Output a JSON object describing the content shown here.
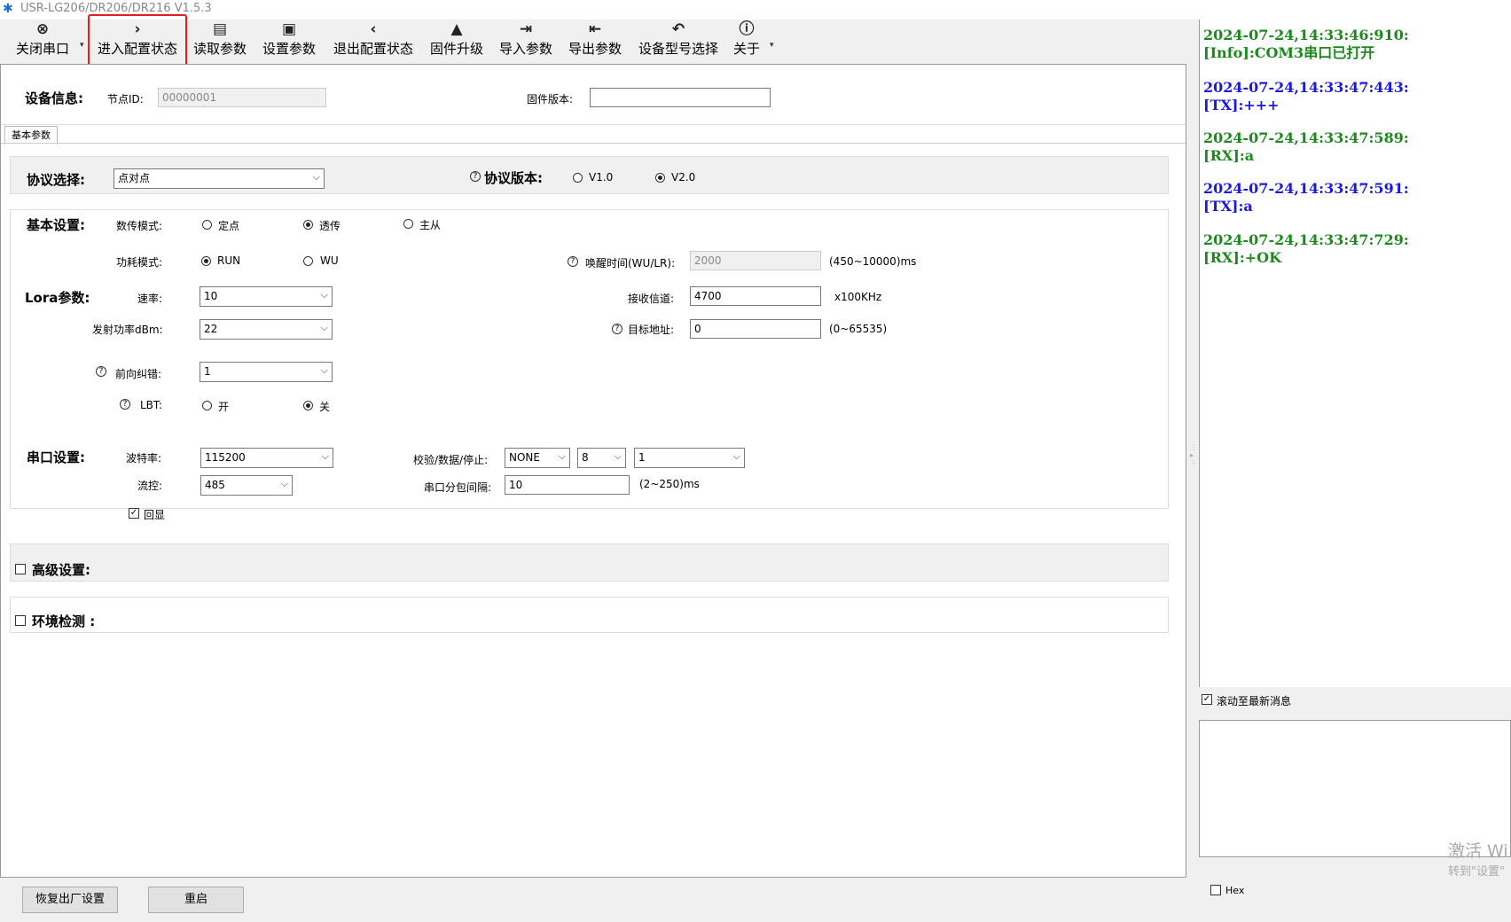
{
  "app": {
    "title": "USR-LG206/DR206/DR216 V1.5.3"
  },
  "toolbar": {
    "buttons": [
      {
        "label": "关闭串口",
        "icon": "⊗"
      },
      {
        "label": "进入配置状态",
        "icon": "›"
      },
      {
        "label": "读取参数",
        "icon": "▤"
      },
      {
        "label": "设置参数",
        "icon": "▣"
      },
      {
        "label": "退出配置状态",
        "icon": "‹"
      },
      {
        "label": "固件升级",
        "icon": "▲"
      },
      {
        "label": "导入参数",
        "icon": "⇥"
      },
      {
        "label": "导出参数",
        "icon": "⇤"
      },
      {
        "label": "设备型号选择",
        "icon": "↶"
      },
      {
        "label": "关于",
        "icon": "ⓘ"
      }
    ],
    "dropdown_glyph": "▾"
  },
  "device": {
    "heading": "设备信息:",
    "node_id_label": "节点ID:",
    "node_id_value": "00000001",
    "firmware_label": "固件版本:",
    "firmware_value": ""
  },
  "tab": {
    "label": "基本参数"
  },
  "protocol": {
    "heading": "协议选择:",
    "value": "点对点",
    "version_heading": "协议版本:",
    "v1": "V1.0",
    "v2": "V2.0"
  },
  "basic": {
    "heading": "基本设置:",
    "transfer_label": "数传模式:",
    "transfer_options": [
      "定点",
      "透传",
      "主从"
    ],
    "power_label": "功耗模式:",
    "power_options": [
      "RUN",
      "WU"
    ],
    "wake_label": "唤醒时间(WU/LR):",
    "wake_value": "2000",
    "wake_unit": "(450~10000)ms"
  },
  "lora": {
    "heading": "Lora参数:",
    "rate_label": "速率:",
    "rate_value": "10",
    "power_label": "发射功率dBm:",
    "power_value": "22",
    "fec_label": "前向纠错:",
    "fec_value": "1",
    "lbt_label": "LBT:",
    "lbt_on": "开",
    "lbt_off": "关",
    "channel_label": "接收信道:",
    "channel_value": "4700",
    "channel_unit": "x100KHz",
    "target_label": "目标地址:",
    "target_value": "0",
    "target_unit": "(0~65535)"
  },
  "serial": {
    "heading": "串口设置:",
    "baud_label": "波特率:",
    "baud_value": "115200",
    "flow_label": "流控:",
    "flow_value": "485",
    "parity_label": "校验/数据/停止:",
    "parity_value": "NONE",
    "data_value": "8",
    "stop_value": "1",
    "interval_label": "串口分包间隔:",
    "interval_value": "10",
    "interval_unit": "(2~250)ms",
    "echo_label": "回显"
  },
  "advanced": {
    "label": "高级设置:"
  },
  "env": {
    "label": "环境检测 :"
  },
  "footer": {
    "restore_label": "恢复出厂设置",
    "reboot_label": "重启"
  },
  "log": {
    "entries": [
      {
        "time": "2024-07-24,14:33:46:910:",
        "msg": "[Info]:COM3串口已打开",
        "color": "#1a8a1a"
      },
      {
        "time": "2024-07-24,14:33:47:443:",
        "msg": "[TX]:+++",
        "color": "#1a1ae0"
      },
      {
        "time": "2024-07-24,14:33:47:589:",
        "msg": "[RX]:a",
        "color": "#1a8a1a"
      },
      {
        "time": "2024-07-24,14:33:47:591:",
        "msg": "[TX]:a",
        "color": "#1a1ae0"
      },
      {
        "time": "2024-07-24,14:33:47:729:",
        "msg": "[RX]:+OK",
        "color": "#1a8a1a"
      }
    ],
    "scroll_label": "滚动至最新消息",
    "hex_label": "Hex"
  },
  "watermark": {
    "line1": "激活 Wi",
    "line2": "转到\"设置\""
  }
}
